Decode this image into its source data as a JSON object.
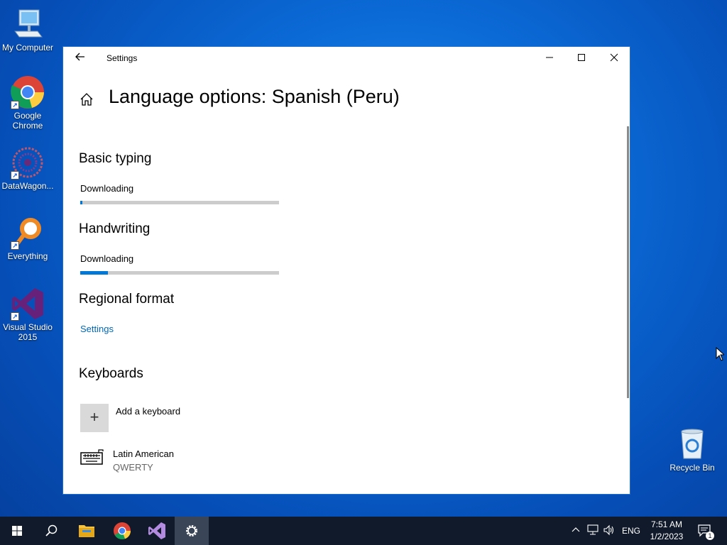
{
  "desktop": {
    "icons": [
      {
        "label": "My Computer"
      },
      {
        "label": "Google Chrome"
      },
      {
        "label": "DataWagon..."
      },
      {
        "label": "Everything"
      },
      {
        "label": "Visual Studio 2015"
      },
      {
        "label": "Recycle Bin"
      }
    ]
  },
  "window": {
    "title": "Settings",
    "back_icon": "back-arrow-icon",
    "controls": {
      "minimize": "minimize-icon",
      "maximize": "maximize-icon",
      "close": "close-icon"
    }
  },
  "page": {
    "title": "Language options: Spanish (Peru)",
    "home_icon": "home-icon"
  },
  "sections": {
    "basic_typing": {
      "title": "Basic typing",
      "status": "Downloading",
      "progress": 0.01
    },
    "handwriting": {
      "title": "Handwriting",
      "status": "Downloading",
      "progress": 0.14
    },
    "regional_format": {
      "title": "Regional format",
      "link": "Settings"
    },
    "keyboards": {
      "title": "Keyboards",
      "add_label": "Add a keyboard",
      "items": [
        {
          "name": "Latin American",
          "layout": "QWERTY"
        }
      ]
    }
  },
  "taskbar": {
    "language": "ENG",
    "time": "7:51 AM",
    "date": "1/2/2023",
    "notification_count": "1"
  },
  "colors": {
    "accent": "#0078d7",
    "link": "#0067b8",
    "taskbar": "#101a2a"
  }
}
